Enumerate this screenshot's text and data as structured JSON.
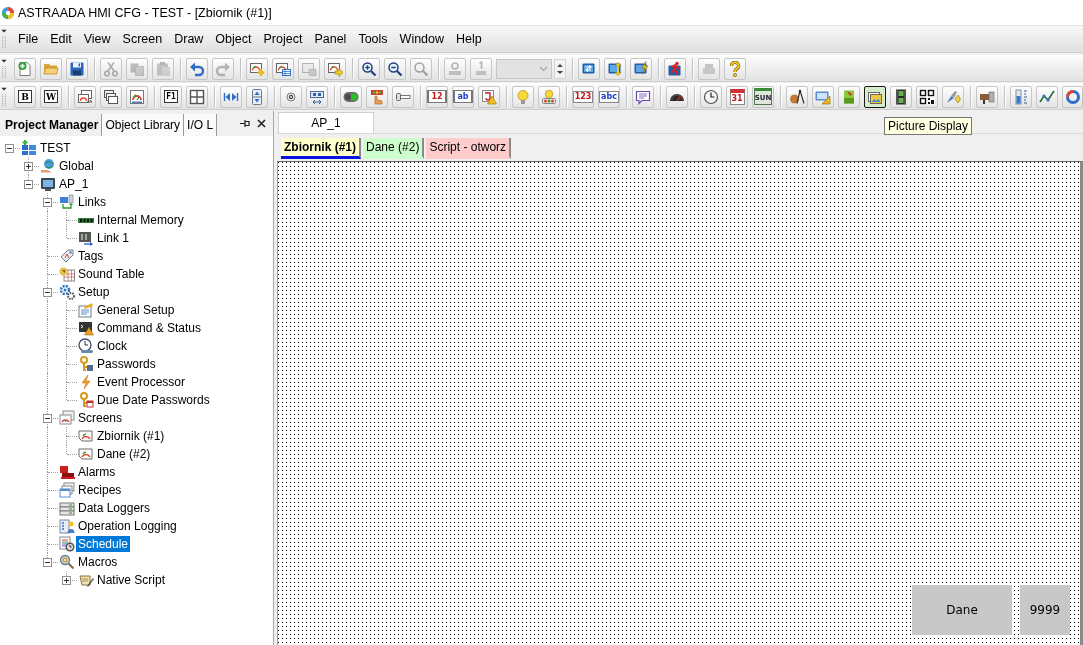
{
  "window": {
    "title": "ASTRAADA HMI CFG - TEST - [Zbiornik (#1)]"
  },
  "menu": [
    {
      "label": "File"
    },
    {
      "label": "Edit"
    },
    {
      "label": "View"
    },
    {
      "label": "Screen"
    },
    {
      "label": "Draw"
    },
    {
      "label": "Object"
    },
    {
      "label": "Project"
    },
    {
      "label": "Panel"
    },
    {
      "label": "Tools"
    },
    {
      "label": "Window"
    },
    {
      "label": "Help"
    }
  ],
  "toolbars": [
    {
      "groups": [
        [
          {
            "kind": "new",
            "disabled": false
          },
          {
            "kind": "open",
            "disabled": false
          },
          {
            "kind": "save",
            "disabled": false
          }
        ],
        [
          {
            "kind": "cut",
            "disabled": true
          },
          {
            "kind": "copy",
            "disabled": true
          },
          {
            "kind": "paste",
            "disabled": true
          }
        ],
        [
          {
            "kind": "undo",
            "disabled": false
          },
          {
            "kind": "redo",
            "disabled": true
          }
        ],
        [
          {
            "kind": "addscreen",
            "disabled": false
          },
          {
            "kind": "screenprops",
            "disabled": false
          },
          {
            "kind": "screenoptions",
            "disabled": true
          },
          {
            "kind": "screenexport",
            "disabled": false
          }
        ],
        [
          {
            "kind": "zoomin",
            "disabled": false
          },
          {
            "kind": "zoomout",
            "disabled": false
          },
          {
            "kind": "zoom",
            "disabled": true
          }
        ],
        [
          {
            "kind": "off",
            "disabled": true
          },
          {
            "kind": "on",
            "disabled": true
          },
          {
            "kind": "zoomlevel",
            "disabled": true
          },
          {
            "kind": "spin",
            "disabled": false
          }
        ],
        [
          {
            "kind": "transfer",
            "disabled": false
          },
          {
            "kind": "upload",
            "disabled": false
          },
          {
            "kind": "flash",
            "disabled": false
          }
        ],
        [
          {
            "kind": "run",
            "disabled": false
          }
        ],
        [
          {
            "kind": "print",
            "disabled": true
          },
          {
            "kind": "help",
            "disabled": false
          }
        ]
      ]
    },
    {
      "groups": [
        [
          {
            "kind": "bit",
            "label": "B",
            "selected": false
          },
          {
            "kind": "word",
            "label": "W",
            "selected": false
          }
        ],
        [
          {
            "kind": "screenjump",
            "selected": false
          },
          {
            "kind": "windows",
            "selected": false
          },
          {
            "kind": "screengauge",
            "selected": false
          }
        ],
        [
          {
            "kind": "fkey",
            "label": "F1",
            "selected": false
          },
          {
            "kind": "grid",
            "selected": false
          }
        ],
        [
          {
            "kind": "step",
            "selected": false
          },
          {
            "kind": "updown",
            "selected": false
          }
        ],
        [
          {
            "kind": "target",
            "selected": false
          },
          {
            "kind": "shift",
            "selected": false
          }
        ],
        [
          {
            "kind": "toggle",
            "selected": false
          },
          {
            "kind": "hand",
            "selected": false
          },
          {
            "kind": "slider",
            "selected": false
          }
        ],
        [
          {
            "kind": "numdisplay",
            "label": "12",
            "selected": false
          },
          {
            "kind": "textdisplay",
            "label": "ab",
            "selected": false
          },
          {
            "kind": "statetile",
            "selected": false
          }
        ],
        [
          {
            "kind": "bulb",
            "selected": false
          },
          {
            "kind": "bulbs",
            "selected": false
          }
        ],
        [
          {
            "kind": "numinput",
            "label": "123",
            "selected": false
          },
          {
            "kind": "textinput",
            "label": "abc",
            "selected": false
          }
        ],
        [
          {
            "kind": "speech",
            "selected": false
          }
        ],
        [
          {
            "kind": "gauge",
            "selected": false
          }
        ],
        [
          {
            "kind": "clock",
            "selected": false
          },
          {
            "kind": "date",
            "label": "31",
            "selected": false
          },
          {
            "kind": "day",
            "label": "SUN",
            "selected": false
          }
        ],
        [
          {
            "kind": "compass",
            "selected": false
          },
          {
            "kind": "ruler",
            "selected": false
          },
          {
            "kind": "imagefile",
            "selected": false
          },
          {
            "kind": "picture",
            "selected": true
          },
          {
            "kind": "film",
            "selected": false
          },
          {
            "kind": "qr",
            "selected": false
          },
          {
            "kind": "pen",
            "selected": false
          }
        ],
        [
          {
            "kind": "pipe",
            "selected": false
          }
        ],
        [
          {
            "kind": "level",
            "selected": false
          },
          {
            "kind": "trend",
            "selected": false
          },
          {
            "kind": "ring",
            "selected": false
          }
        ]
      ]
    }
  ],
  "panel_tabs": [
    {
      "label": "Project Manager",
      "selected": true
    },
    {
      "label": "Object Library",
      "selected": false
    },
    {
      "label": "I/O L",
      "selected": false
    }
  ],
  "project_tree": [
    {
      "label": "TEST",
      "kind": "project",
      "expanded": true,
      "selected": false,
      "children": [
        {
          "label": "Global",
          "kind": "global",
          "expanded": false,
          "selected": false
        },
        {
          "label": "AP_1",
          "kind": "panel",
          "expanded": true,
          "selected": false,
          "children": [
            {
              "label": "Links",
              "kind": "links",
              "expanded": true,
              "selected": false,
              "children": [
                {
                  "label": "Internal Memory",
                  "kind": "memory",
                  "selected": false
                },
                {
                  "label": "Link 1",
                  "kind": "link",
                  "selected": false
                }
              ]
            },
            {
              "label": "Tags",
              "kind": "tags",
              "selected": false
            },
            {
              "label": "Sound Table",
              "kind": "sound",
              "selected": false
            },
            {
              "label": "Setup",
              "kind": "setup",
              "expanded": true,
              "selected": false,
              "children": [
                {
                  "label": "General Setup",
                  "kind": "general",
                  "selected": false
                },
                {
                  "label": "Command & Status",
                  "kind": "command",
                  "selected": false
                },
                {
                  "label": "Clock",
                  "kind": "clock",
                  "selected": false
                },
                {
                  "label": "Passwords",
                  "kind": "passwords",
                  "selected": false
                },
                {
                  "label": "Event Processor",
                  "kind": "events",
                  "selected": false
                },
                {
                  "label": "Due Date Passwords",
                  "kind": "duedate",
                  "selected": false
                }
              ]
            },
            {
              "label": "Screens",
              "kind": "screens",
              "expanded": true,
              "selected": false,
              "children": [
                {
                  "label": "Zbiornik (#1)",
                  "kind": "screen",
                  "selected": false
                },
                {
                  "label": "Dane (#2)",
                  "kind": "screen",
                  "selected": false
                }
              ]
            },
            {
              "label": "Alarms",
              "kind": "alarms",
              "selected": false
            },
            {
              "label": "Recipes",
              "kind": "recipes",
              "selected": false
            },
            {
              "label": "Data Loggers",
              "kind": "loggers",
              "selected": false
            },
            {
              "label": "Operation Logging",
              "kind": "oplog",
              "selected": false
            },
            {
              "label": "Schedule",
              "kind": "schedule",
              "selected": true
            },
            {
              "label": "Macros",
              "kind": "macros",
              "expanded": true,
              "selected": false,
              "children": [
                {
                  "label": "Native Script",
                  "kind": "script",
                  "expanded": false,
                  "selected": false
                }
              ]
            }
          ]
        }
      ]
    }
  ],
  "document_tabs": [
    {
      "label": "AP_1",
      "selected": true
    }
  ],
  "tooltip": {
    "text": "Picture Display"
  },
  "screen_tabs": [
    {
      "label": "Zbiornik (#1)",
      "color": "#ffffcc",
      "selected": true
    },
    {
      "label": "Dane (#2)",
      "color": "#ccffcc",
      "selected": false
    },
    {
      "label": "Script - otworz",
      "color": "#ffcccc",
      "selected": false
    }
  ],
  "canvas": {
    "objects": [
      {
        "kind": "button",
        "label": "Dane"
      },
      {
        "kind": "numeric",
        "label": "9999"
      }
    ]
  }
}
